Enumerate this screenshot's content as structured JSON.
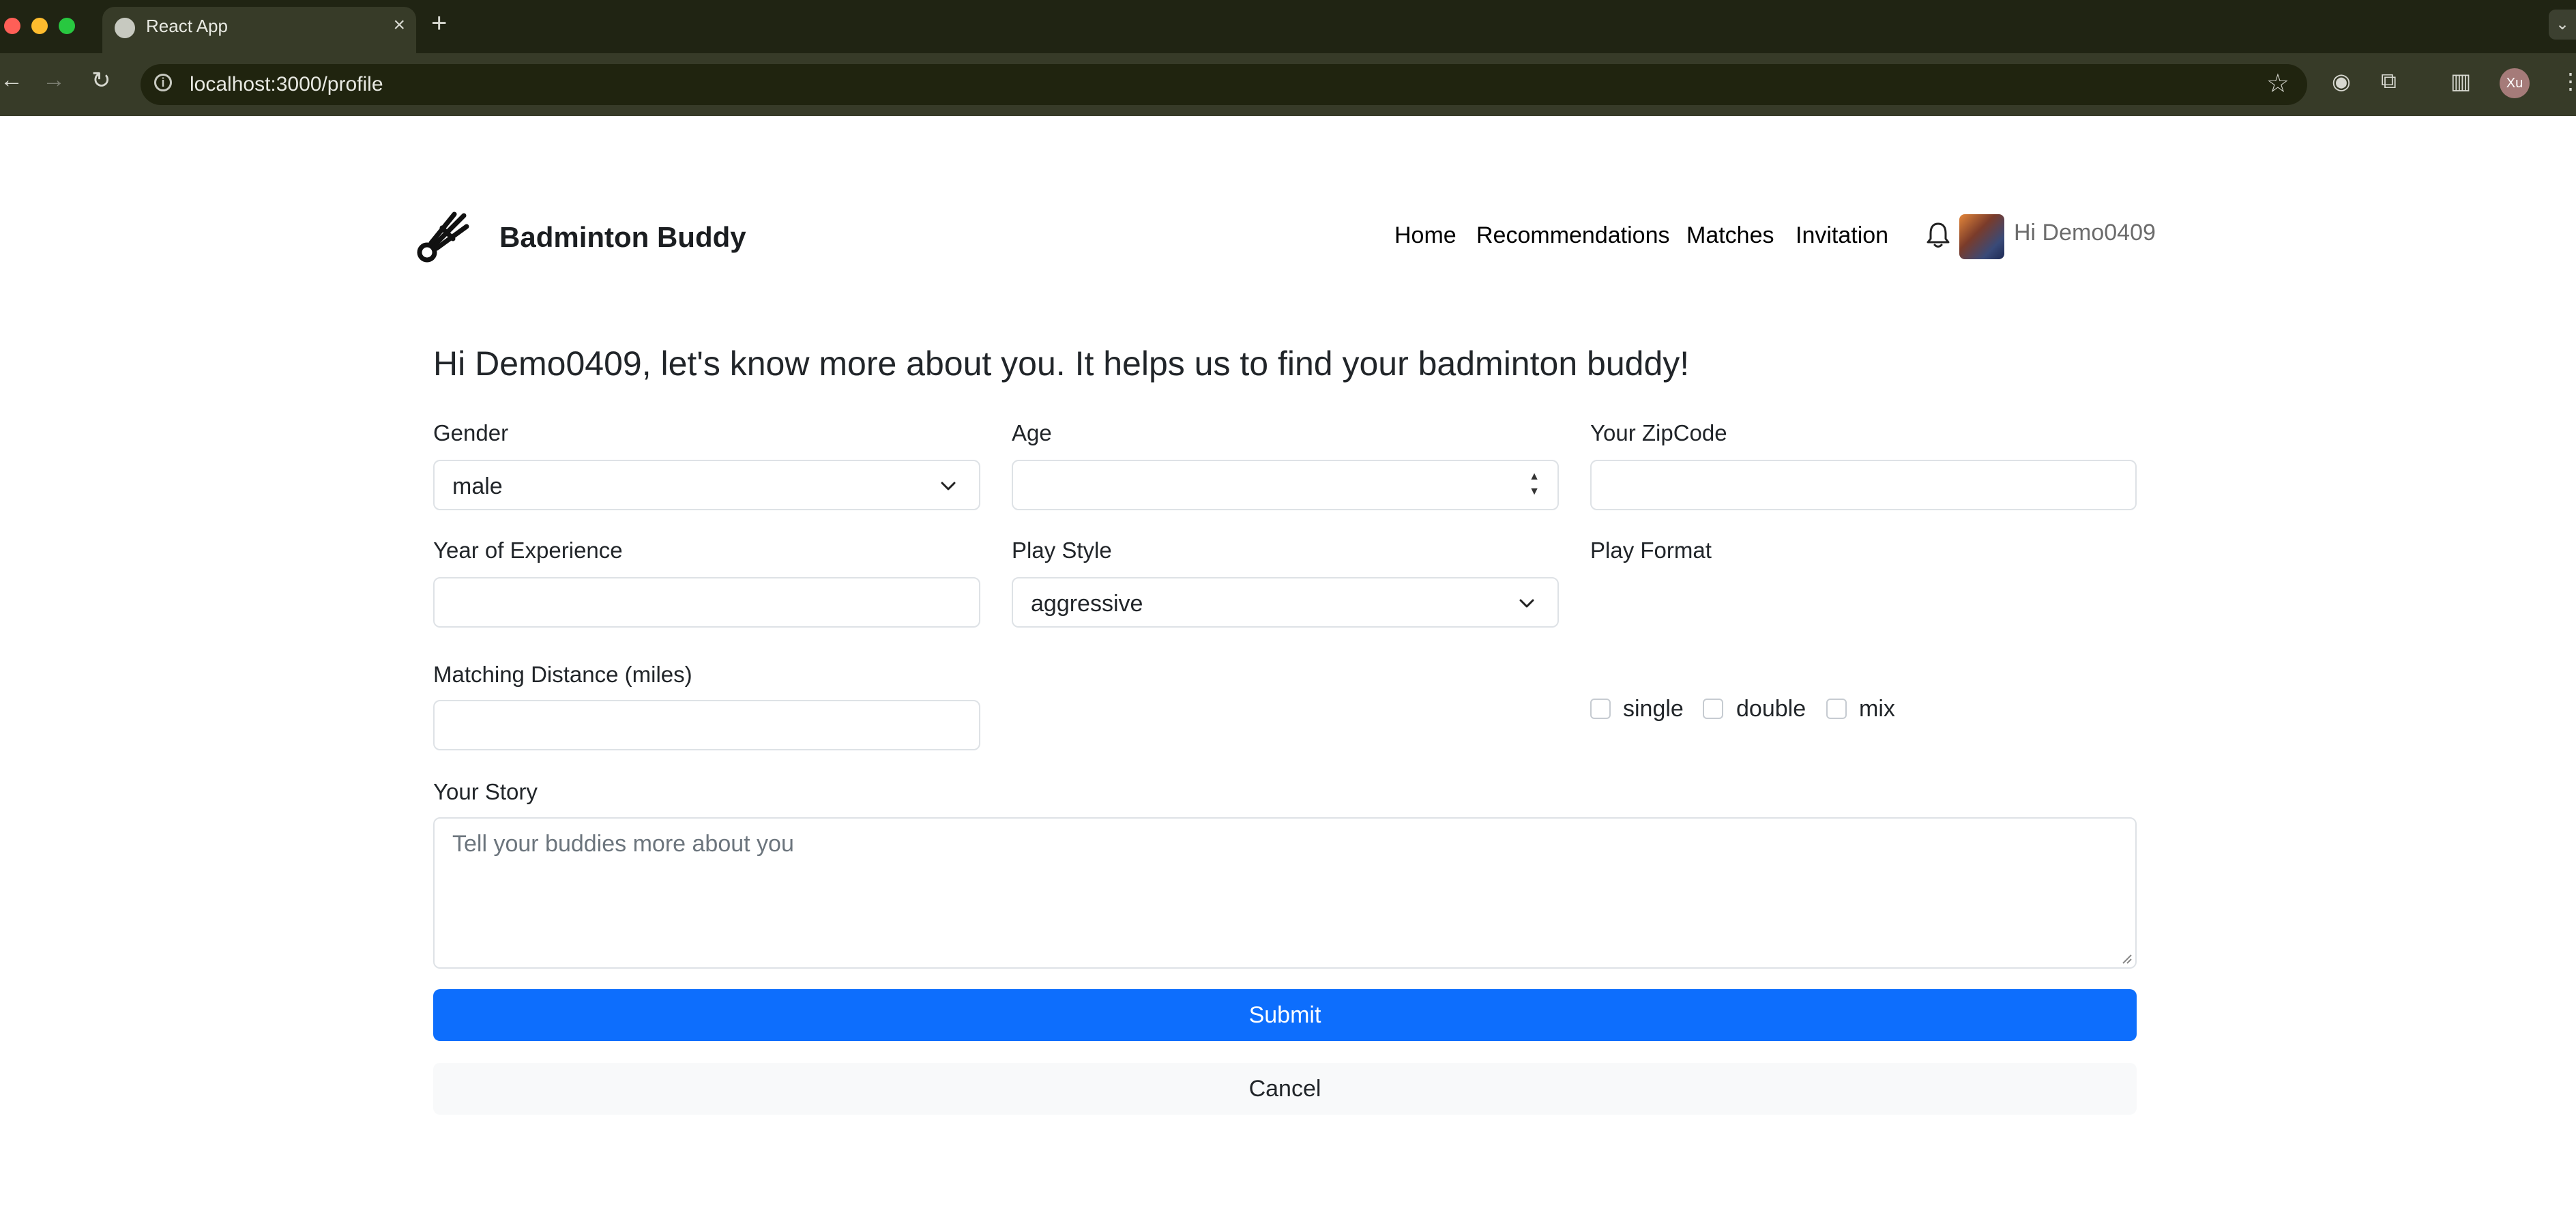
{
  "browser": {
    "tab_title": "React App",
    "new_tab_symbol": "+",
    "url": "localhost:3000/profile",
    "profile_initials": "Xu"
  },
  "navbar": {
    "brand": "Badminton Buddy",
    "links": [
      "Home",
      "Recommendations",
      "Matches",
      "Invitation"
    ],
    "greeting": "Hi Demo0409"
  },
  "form": {
    "heading": "Hi Demo0409, let's know more about you. It helps us to find your badminton buddy!",
    "gender": {
      "label": "Gender",
      "value": "male"
    },
    "age": {
      "label": "Age",
      "value": ""
    },
    "zipcode": {
      "label": "Your ZipCode",
      "value": ""
    },
    "experience": {
      "label": "Year of Experience",
      "value": ""
    },
    "play_style": {
      "label": "Play Style",
      "value": "aggressive"
    },
    "play_format": {
      "label": "Play Format",
      "options": [
        "single",
        "double",
        "mix"
      ]
    },
    "distance": {
      "label": "Matching Distance (miles)",
      "value": ""
    },
    "story": {
      "label": "Your Story",
      "placeholder": "Tell your buddies more about you"
    },
    "submit_label": "Submit",
    "cancel_label": "Cancel"
  },
  "colors": {
    "primary": "#0d6efd",
    "chrome_dark": "#202413",
    "chrome_toolbar": "#373b28"
  },
  "icons": [
    "shuttlecock-logo-icon",
    "bell-icon",
    "chevron-down-icon",
    "globe-icon",
    "info-icon",
    "star-icon"
  ]
}
